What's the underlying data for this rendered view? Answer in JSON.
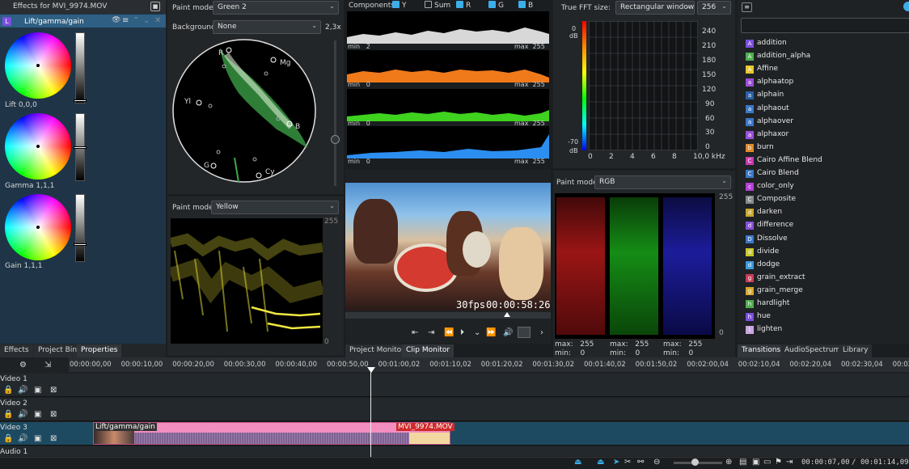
{
  "effects_panel": {
    "title": "Effects for MVI_9974.MOV",
    "effect_name": "Lift/gamma/gain",
    "effect_badge": "L",
    "wheels": [
      {
        "label": "Lift 0,0,0",
        "slider_level": 0.05
      },
      {
        "label": "Gamma 1,1,1",
        "slider_level": 0.5
      },
      {
        "label": "Gain 1,1,1",
        "slider_level": 0.25
      }
    ]
  },
  "vectorscope": {
    "paint_mode_label": "Paint mode",
    "paint_mode_value": "Green 2",
    "background_label": "Background",
    "background_value": "None",
    "zoom": "2,3x",
    "targets": [
      "R",
      "Mg",
      "B",
      "Cy",
      "G",
      "Yl"
    ]
  },
  "waveform": {
    "paint_mode_label": "Paint mode",
    "paint_mode_value": "Yellow",
    "max": "255",
    "min": "0"
  },
  "histogram": {
    "components_label": "Components",
    "checks": [
      {
        "label": "Y",
        "on": true
      },
      {
        "label": "Sum",
        "on": false
      },
      {
        "label": "R",
        "on": true
      },
      {
        "label": "G",
        "on": true
      },
      {
        "label": "B",
        "on": true
      }
    ],
    "rows": [
      {
        "min_label": "min",
        "min_value": "2",
        "max_label": "max",
        "max_value": "255",
        "color": "#d8d8d8"
      },
      {
        "min_label": "min",
        "min_value": "0",
        "max_label": "max",
        "max_value": "255",
        "color": "#f07a1a"
      },
      {
        "min_label": "min",
        "min_value": "0",
        "max_label": "max",
        "max_value": "255",
        "color": "#3fd21e"
      },
      {
        "min_label": "min",
        "min_value": "0",
        "max_label": "max",
        "max_value": "255",
        "color": "#2c8ef0"
      }
    ]
  },
  "audio_spectrum": {
    "fft_label": "True FFT size:",
    "window_value": "Rectangular window",
    "size_value": "256",
    "db_top": "0",
    "db_unit": "dB",
    "db_bottom": "-70",
    "y_ticks": [
      "240",
      "210",
      "180",
      "150",
      "120",
      "90",
      "60",
      "30",
      "0"
    ],
    "x_ticks": [
      "0",
      "2",
      "4",
      "6",
      "8",
      "10,0 kHz"
    ]
  },
  "rgb_parade": {
    "paint_mode_label": "Paint mode",
    "paint_mode_value": "RGB",
    "max_top": "255",
    "min_bottom": "0",
    "stats": [
      {
        "max_label": "max:",
        "max_value": "255",
        "min_label": "min:",
        "min_value": "0"
      },
      {
        "max_label": "max:",
        "max_value": "255",
        "min_label": "min:",
        "min_value": "0"
      },
      {
        "max_label": "max:",
        "max_value": "255",
        "min_label": "min:",
        "min_value": "0"
      }
    ]
  },
  "monitor": {
    "fps": "30fps",
    "timecode": "00:00:58:26",
    "tabs": [
      "Project Monitor",
      "Clip Monitor"
    ]
  },
  "left_tabs": [
    "Effects",
    "Project Bin",
    "Properties"
  ],
  "right_tabs": [
    "Transitions",
    "AudioSpectrum",
    "Library"
  ],
  "effects_list": [
    {
      "name": "addition",
      "color": "#7b4fe0",
      "icon": "A"
    },
    {
      "name": "addition_alpha",
      "color": "#4fae4f",
      "icon": "A"
    },
    {
      "name": "Affine",
      "color": "#e6c72b",
      "icon": "A"
    },
    {
      "name": "alphaatop",
      "color": "#9b4fd8",
      "icon": "a"
    },
    {
      "name": "alphain",
      "color": "#2a5fa8",
      "icon": "a"
    },
    {
      "name": "alphaout",
      "color": "#3c78c8",
      "icon": "a"
    },
    {
      "name": "alphaover",
      "color": "#3c78c8",
      "icon": "a"
    },
    {
      "name": "alphaxor",
      "color": "#9b4fd8",
      "icon": "a"
    },
    {
      "name": "burn",
      "color": "#e08a2b",
      "icon": "b"
    },
    {
      "name": "Cairo Affine Blend",
      "color": "#c73db0",
      "icon": "C"
    },
    {
      "name": "Cairo Blend",
      "color": "#3c78c8",
      "icon": "C"
    },
    {
      "name": "color_only",
      "color": "#b53fd8",
      "icon": "c"
    },
    {
      "name": "Composite",
      "color": "#8a8a8a",
      "icon": "C"
    },
    {
      "name": "darken",
      "color": "#c8a82b",
      "icon": "d"
    },
    {
      "name": "difference",
      "color": "#8a4fd8",
      "icon": "d"
    },
    {
      "name": "Dissolve",
      "color": "#3c78c8",
      "icon": "D"
    },
    {
      "name": "divide",
      "color": "#c8c82b",
      "icon": "d"
    },
    {
      "name": "dodge",
      "color": "#3c9ad8",
      "icon": "d"
    },
    {
      "name": "grain_extract",
      "color": "#c83d5a",
      "icon": "g"
    },
    {
      "name": "grain_merge",
      "color": "#d8a82b",
      "icon": "g"
    },
    {
      "name": "hardlight",
      "color": "#4fae4f",
      "icon": "h"
    },
    {
      "name": "hue",
      "color": "#7b4fe0",
      "icon": "h"
    },
    {
      "name": "lighten",
      "color": "#c8a8e0",
      "icon": "l"
    }
  ],
  "timeline": {
    "ruler": [
      "00:00:00,00",
      "00:00:10,00",
      "00:00:20,00",
      "00:00:30,00",
      "00:00:40,00",
      "00:00:50,00",
      "00:01:00,02",
      "00:01:10,02",
      "00:01:20,02",
      "00:01:30,02",
      "00:01:40,02",
      "00:01:50,02",
      "00:02:00,04",
      "00:02:10,04",
      "00:02:20,04",
      "00:02:30,04",
      "00:02"
    ],
    "tracks": [
      "Video 1",
      "Video 2",
      "Video 3",
      "Audio 1"
    ],
    "clip_effect": "Lift/gamma/gain",
    "clip_name": "MVI_9974.MOV",
    "position": "00:00:07,00",
    "separator": "/",
    "duration": "00:01:14,09"
  }
}
